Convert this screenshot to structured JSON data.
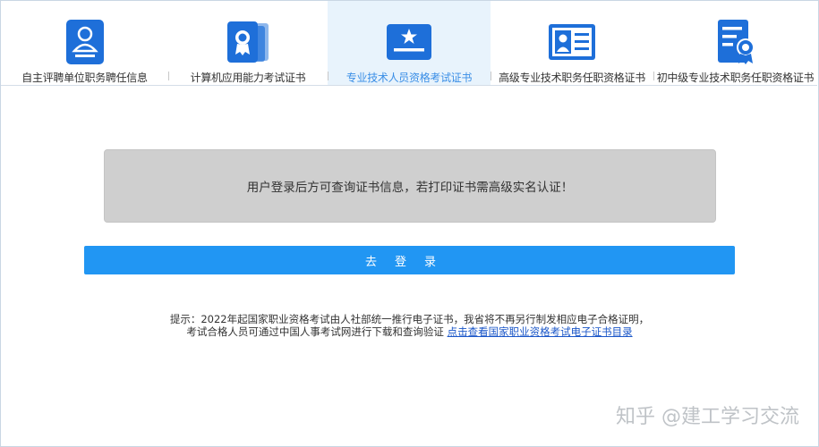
{
  "tabs": [
    {
      "label": "自主评聘单位职务聘任信息",
      "icon": "person-document-icon",
      "active": false
    },
    {
      "label": "计算机应用能力考试证书",
      "icon": "certificate-ribbon-icon",
      "active": false
    },
    {
      "label": "专业技术人员资格考试证书",
      "icon": "star-certificate-icon",
      "active": true
    },
    {
      "label": "高级专业技术职务任职资格证书",
      "icon": "id-card-icon",
      "active": false
    },
    {
      "label": "初中级专业技术职务任职资格证书",
      "icon": "award-document-icon",
      "active": false
    }
  ],
  "notice": "用户登录后方可查询证书信息，若打印证书需高级实名认证！",
  "login_button": "去登录",
  "tip": {
    "line1": "提示：2022年起国家职业资格考试由人社部统一推行电子证书，我省将不再另行制发相应电子合格证明，",
    "line2": "考试合格人员可通过中国人事考试网进行下载和查询验证",
    "link": "点击查看国家职业资格考试电子证书目录"
  },
  "watermark": "知乎 @建工学习交流",
  "colors": {
    "icon_blue": "#1e6fd9",
    "button_blue": "#2196f3",
    "active_tab_bg": "#e8f3fc",
    "link": "#1a56c8"
  }
}
